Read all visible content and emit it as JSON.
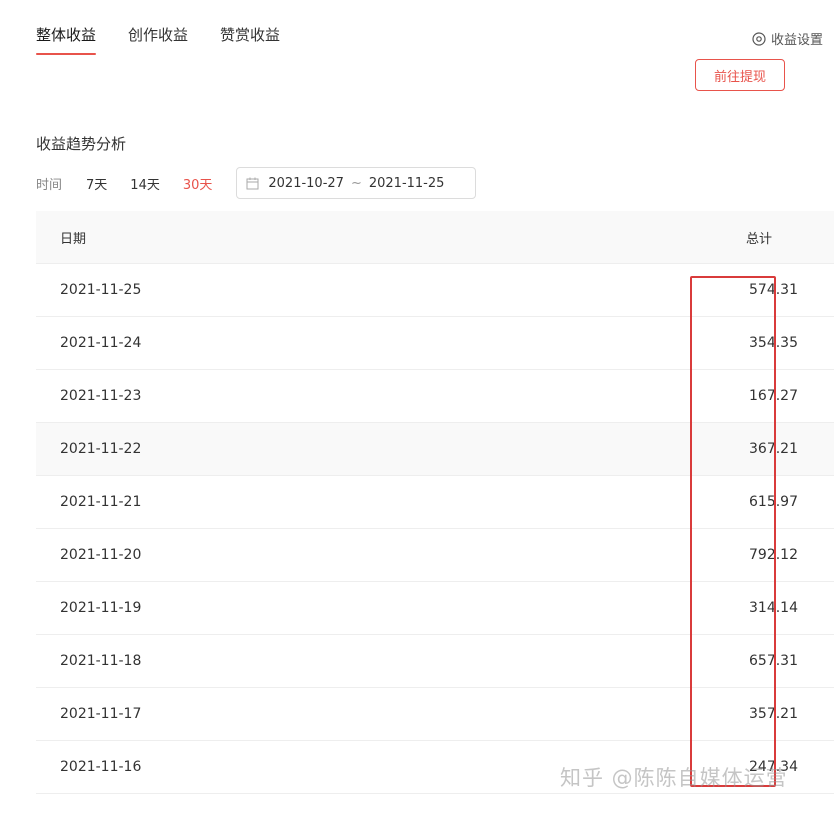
{
  "tabs": [
    {
      "label": "整体收益",
      "active": true
    },
    {
      "label": "创作收益",
      "active": false
    },
    {
      "label": "赞赏收益",
      "active": false
    }
  ],
  "settings": {
    "label": "收益设置",
    "icon": "target-icon"
  },
  "withdraw": {
    "label": "前往提现"
  },
  "section": {
    "title": "收益趋势分析"
  },
  "filter": {
    "label": "时间",
    "ranges": [
      "7天",
      "14天",
      "30天"
    ],
    "active_range": "30天",
    "date_start": "2021-10-27",
    "date_sep": "~",
    "date_end": "2021-11-25"
  },
  "table": {
    "headers": {
      "date": "日期",
      "total": "总计"
    },
    "rows": [
      {
        "date": "2021-11-25",
        "total": "574.31"
      },
      {
        "date": "2021-11-24",
        "total": "354.35"
      },
      {
        "date": "2021-11-23",
        "total": "167.27"
      },
      {
        "date": "2021-11-22",
        "total": "367.21"
      },
      {
        "date": "2021-11-21",
        "total": "615.97"
      },
      {
        "date": "2021-11-20",
        "total": "792.12"
      },
      {
        "date": "2021-11-19",
        "total": "314.14"
      },
      {
        "date": "2021-11-18",
        "total": "657.31"
      },
      {
        "date": "2021-11-17",
        "total": "357.21"
      },
      {
        "date": "2021-11-16",
        "total": "247.34"
      }
    ]
  },
  "watermark": "知乎 @陈陈自媒体运营",
  "colors": {
    "accent": "#e8534b",
    "highlight_box": "#d93b3b"
  }
}
